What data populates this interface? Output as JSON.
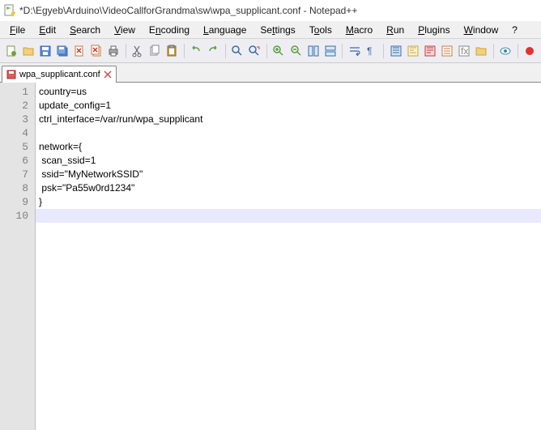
{
  "title": "*D:\\Egyeb\\Arduino\\VideoCallforGrandma\\sw\\wpa_supplicant.conf - Notepad++",
  "menu": {
    "file": "File",
    "edit": "Edit",
    "search": "Search",
    "view": "View",
    "encoding": "Encoding",
    "language": "Language",
    "settings": "Settings",
    "tools": "Tools",
    "macro": "Macro",
    "run": "Run",
    "plugins": "Plugins",
    "window": "Window",
    "help": "?"
  },
  "tab": {
    "label": "wpa_supplicant.conf"
  },
  "lines": [
    "1",
    "2",
    "3",
    "4",
    "5",
    "6",
    "7",
    "8",
    "9",
    "10"
  ],
  "code": {
    "l1": "country=us",
    "l2": "update_config=1",
    "l3": "ctrl_interface=/var/run/wpa_supplicant",
    "l4": "",
    "l5": "network={",
    "l6": " scan_ssid=1",
    "l7": " ssid=\"MyNetworkSSID\"",
    "l8": " psk=\"Pa55w0rd1234\"",
    "l9": "}",
    "l10": ""
  },
  "currentLine": 10
}
